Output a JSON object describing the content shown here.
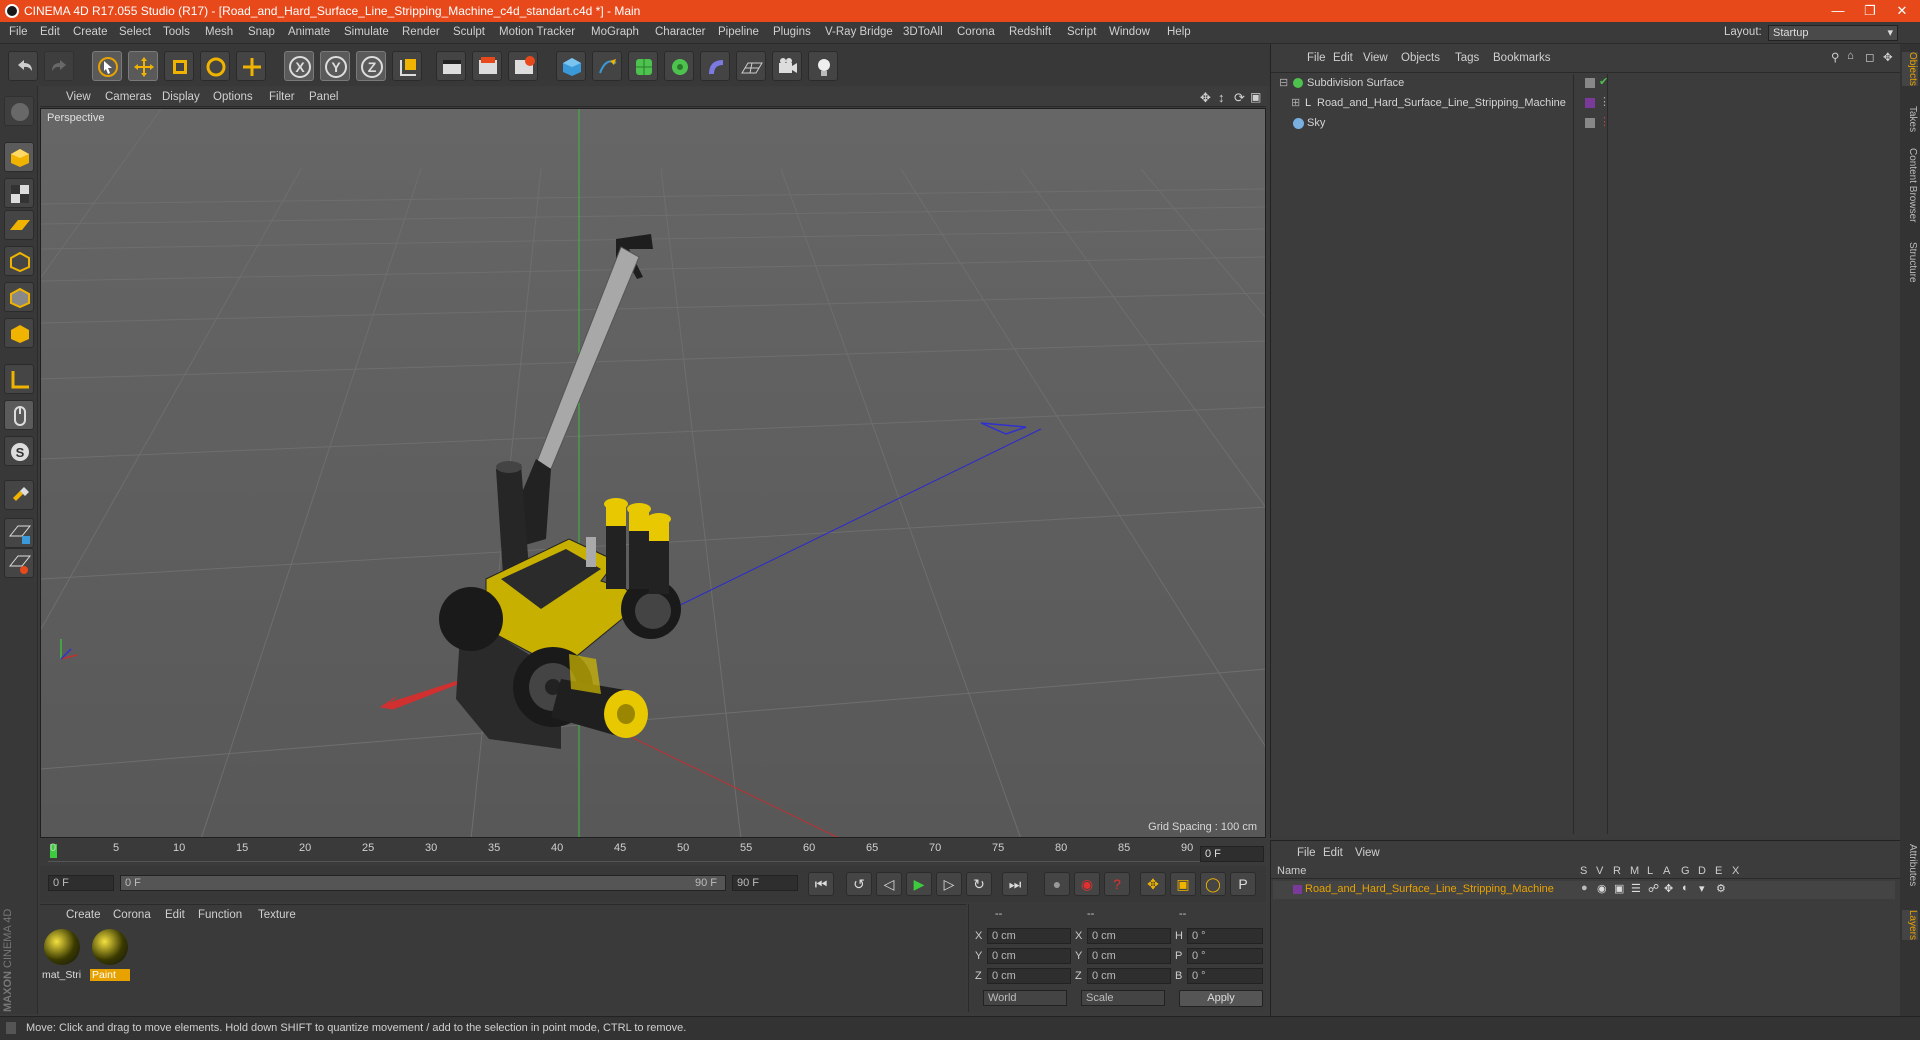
{
  "app": {
    "title": "CINEMA 4D R17.055 Studio (R17) - [Road_and_Hard_Surface_Line_Stripping_Machine_c4d_standart.c4d *] - Main",
    "layout_label": "Layout:",
    "layout_value": "Startup"
  },
  "menus": [
    "File",
    "Edit",
    "Create",
    "Select",
    "Tools",
    "Mesh",
    "Snap",
    "Animate",
    "Simulate",
    "Render",
    "Sculpt",
    "Motion Tracker",
    "MoGraph",
    "Character",
    "Pipeline",
    "Plugins",
    "V-Ray Bridge",
    "3DToAll",
    "Corona",
    "Redshift",
    "Script",
    "Window",
    "Help"
  ],
  "viewport": {
    "menus": [
      "View",
      "Cameras",
      "Display",
      "Options",
      "Filter",
      "Panel"
    ],
    "label": "Perspective",
    "grid_spacing": "Grid Spacing : 100 cm"
  },
  "timeline": {
    "ticks": [
      "0",
      "5",
      "10",
      "15",
      "20",
      "25",
      "30",
      "35",
      "40",
      "45",
      "50",
      "55",
      "60",
      "65",
      "70",
      "75",
      "80",
      "85",
      "90"
    ],
    "current_frame": "0 F",
    "start": "0 F",
    "range_start": "0 F",
    "range_end": "90 F",
    "end": "90 F"
  },
  "materials": {
    "menus": [
      "Create",
      "Corona",
      "Edit",
      "Function",
      "Texture"
    ],
    "items": [
      {
        "name": "mat_Stri",
        "selected": false
      },
      {
        "name": "Paint",
        "selected": true
      }
    ]
  },
  "coords": {
    "headers": [
      "--",
      "--",
      "--"
    ],
    "rows": [
      {
        "a": "X",
        "av": "0 cm",
        "b": "X",
        "bv": "0 cm",
        "c": "H",
        "cv": "0 °"
      },
      {
        "a": "Y",
        "av": "0 cm",
        "b": "Y",
        "bv": "0 cm",
        "c": "P",
        "cv": "0 °"
      },
      {
        "a": "Z",
        "av": "0 cm",
        "b": "Z",
        "bv": "0 cm",
        "c": "B",
        "cv": "0 °"
      }
    ],
    "world": "World",
    "scale": "Scale",
    "apply": "Apply"
  },
  "objects": {
    "menus": [
      "File",
      "Edit",
      "View",
      "Objects",
      "Tags",
      "Bookmarks"
    ],
    "items": [
      {
        "name": "Subdivision Surface",
        "icon": "subdivision-icon"
      },
      {
        "name": "Road_and_Hard_Surface_Line_Stripping_Machine",
        "icon": "null-icon"
      },
      {
        "name": "Sky",
        "icon": "sky-icon"
      }
    ]
  },
  "layers": {
    "menus": [
      "File",
      "Edit",
      "View"
    ],
    "name_header": "Name",
    "cols": [
      "S",
      "V",
      "R",
      "M",
      "L",
      "A",
      "G",
      "D",
      "E",
      "X"
    ],
    "item": "Road_and_Hard_Surface_Line_Stripping_Machine"
  },
  "right_tabs": [
    "Objects",
    "Takes",
    "Content Browser",
    "Structure"
  ],
  "right_tabs_bottom": [
    "Attributes",
    "Layers"
  ],
  "status": "Move: Click and drag to move elements. Hold down SHIFT to quantize movement / add to the selection in point mode, CTRL to remove.",
  "brand": {
    "maxon": "MAXON",
    "product": "CINEMA 4D"
  },
  "colors": {
    "title": "#e8491b",
    "accent_yellow": "#e8c800",
    "layer_text": "#e8a200"
  }
}
